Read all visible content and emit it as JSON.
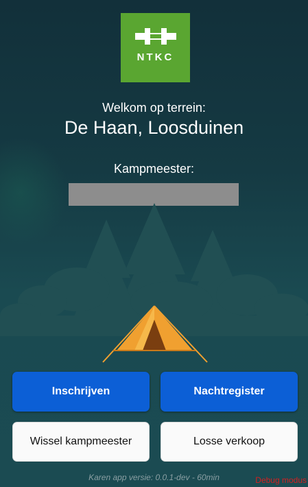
{
  "logo": {
    "text": "NTKC",
    "color": "#5aa631"
  },
  "welcome": {
    "label": "Welkom op terrein:",
    "site_name": "De Haan, Loosduinen"
  },
  "kampmeester": {
    "label": "Kampmeester:",
    "name": ""
  },
  "buttons": {
    "inschrijven": "Inschrijven",
    "nachtregister": "Nachtregister",
    "wissel_kampmeester": "Wissel kampmeester",
    "losse_verkoop": "Losse verkoop"
  },
  "footer": {
    "version": "Karen app versie: 0.0.1-dev - 60min",
    "debug": "Debug modus"
  },
  "colors": {
    "primary": "#0c5fd6",
    "tent": "#f0a030",
    "background": "#153a43"
  }
}
